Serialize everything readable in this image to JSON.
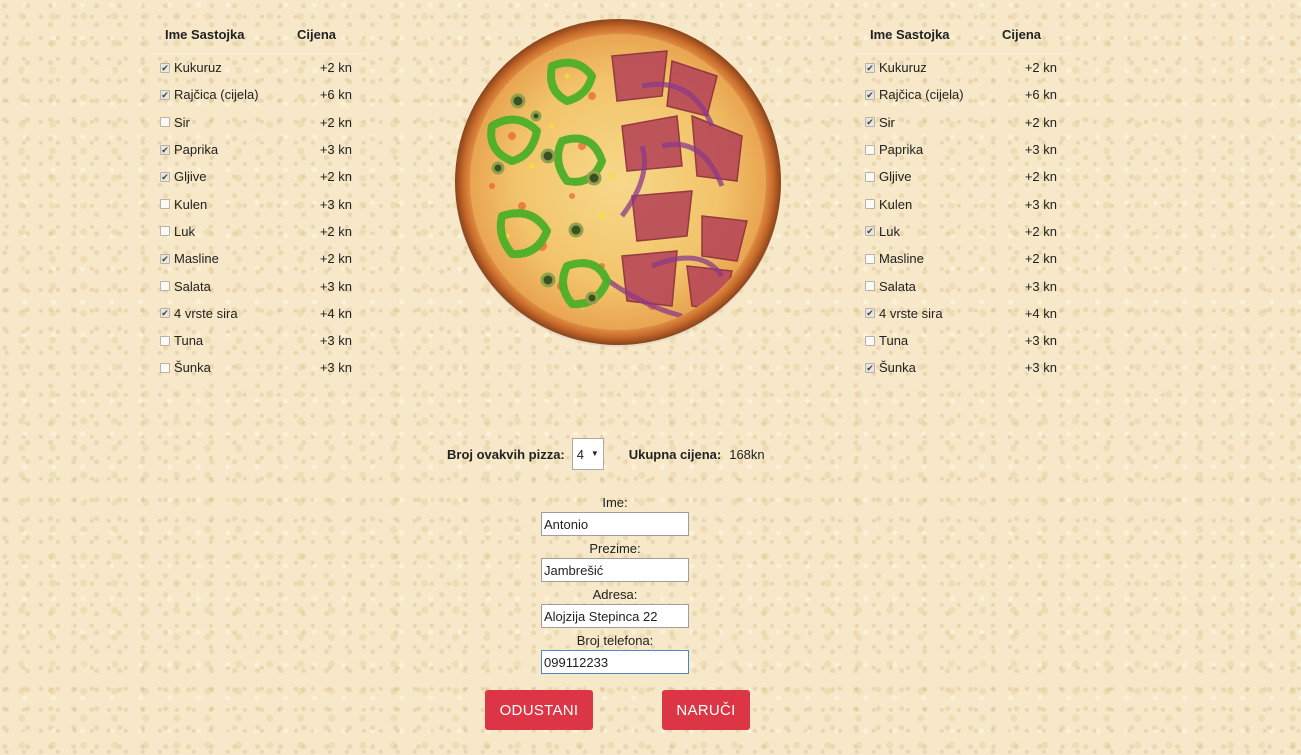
{
  "left_table": {
    "header_name": "Ime Sastojka",
    "header_price": "Cijena",
    "items": [
      {
        "label": "Kukuruz",
        "price": "+2 kn",
        "checked": true
      },
      {
        "label": "Rajčica (cijela)",
        "price": "+6 kn",
        "checked": true
      },
      {
        "label": "Sir",
        "price": "+2 kn",
        "checked": false
      },
      {
        "label": "Paprika",
        "price": "+3 kn",
        "checked": true
      },
      {
        "label": "Gljive",
        "price": "+2 kn",
        "checked": true
      },
      {
        "label": "Kulen",
        "price": "+3 kn",
        "checked": false
      },
      {
        "label": "Luk",
        "price": "+2 kn",
        "checked": false
      },
      {
        "label": "Masline",
        "price": "+2 kn",
        "checked": true
      },
      {
        "label": "Salata",
        "price": "+3 kn",
        "checked": false
      },
      {
        "label": "4 vrste sira",
        "price": "+4 kn",
        "checked": true
      },
      {
        "label": "Tuna",
        "price": "+3 kn",
        "checked": false
      },
      {
        "label": "Šunka",
        "price": "+3 kn",
        "checked": false
      }
    ]
  },
  "right_table": {
    "header_name": "Ime Sastojka",
    "header_price": "Cijena",
    "items": [
      {
        "label": "Kukuruz",
        "price": "+2 kn",
        "checked": true
      },
      {
        "label": "Rajčica (cijela)",
        "price": "+6 kn",
        "checked": true
      },
      {
        "label": "Sir",
        "price": "+2 kn",
        "checked": true
      },
      {
        "label": "Paprika",
        "price": "+3 kn",
        "checked": false
      },
      {
        "label": "Gljive",
        "price": "+2 kn",
        "checked": false
      },
      {
        "label": "Kulen",
        "price": "+3 kn",
        "checked": false
      },
      {
        "label": "Luk",
        "price": "+2 kn",
        "checked": true
      },
      {
        "label": "Masline",
        "price": "+2 kn",
        "checked": false
      },
      {
        "label": "Salata",
        "price": "+3 kn",
        "checked": false
      },
      {
        "label": "4 vrste sira",
        "price": "+4 kn",
        "checked": true
      },
      {
        "label": "Tuna",
        "price": "+3 kn",
        "checked": false
      },
      {
        "label": "Šunka",
        "price": "+3 kn",
        "checked": true
      }
    ]
  },
  "order": {
    "quantity_label": "Broj ovakvih pizza:",
    "quantity_value": "4",
    "total_label": "Ukupna cijena:",
    "total_value": "168kn"
  },
  "form": {
    "first_name_label": "Ime:",
    "first_name_value": "Antonio",
    "last_name_label": "Prezime:",
    "last_name_value": "Jambrešić",
    "address_label": "Adresa:",
    "address_value": "Alojzija Stepinca 22",
    "phone_label": "Broj telefona:",
    "phone_value": "099112233"
  },
  "buttons": {
    "cancel_label": "ODUSTANI",
    "order_label": "NARUČI"
  },
  "colors": {
    "button": "#dc3545",
    "background": "#f6e8c8"
  }
}
